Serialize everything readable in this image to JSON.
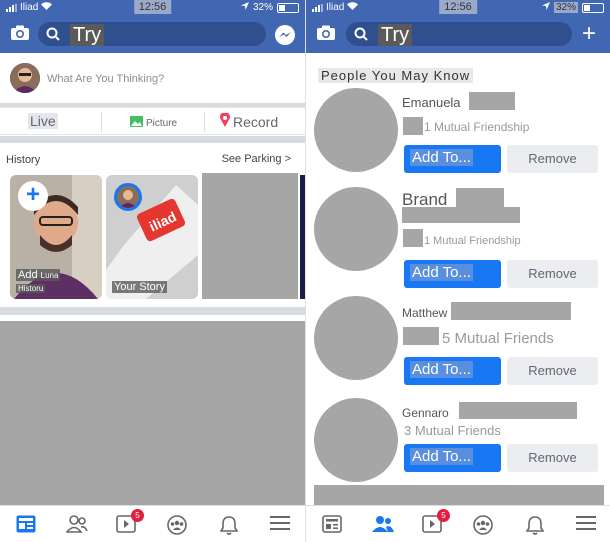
{
  "status": {
    "carrier": "Iliad",
    "time": "12:56",
    "battery": "32%"
  },
  "search": {
    "query": "Try"
  },
  "left": {
    "composer_placeholder": "What Are You Thinking?",
    "actions": {
      "live": "Live",
      "picture": "Picture",
      "record": "Record"
    },
    "stories_label": "History",
    "see_more": "See Parking >",
    "stories": [
      {
        "caption_line1": "Add",
        "caption_extra": "Luna",
        "caption_line2": "Historu"
      },
      {
        "caption": "Your Story",
        "brand": "iliad"
      }
    ]
  },
  "right": {
    "section_title": "People You May Know",
    "people": [
      {
        "name": "Emanuela",
        "mutual": "1 Mutual Friendship",
        "add_label": "Add To...",
        "remove_label": "Remove"
      },
      {
        "name": "Brand",
        "mutual": "1 Mutual Friendship",
        "add_label": "Add To...",
        "remove_label": "Remove"
      },
      {
        "name": "Matthew",
        "mutual": "5 Mutual Friends",
        "add_label": "Add To...",
        "remove_label": "Remove"
      },
      {
        "name": "Gennaro",
        "mutual": "3 Mutual Friends",
        "add_label": "Add To...",
        "remove_label": "Remove"
      }
    ]
  },
  "nav": {
    "video_badge": "5"
  },
  "colors": {
    "brand": "#4267b2",
    "primary_button": "#1877f2",
    "badge": "#e41e3f"
  }
}
